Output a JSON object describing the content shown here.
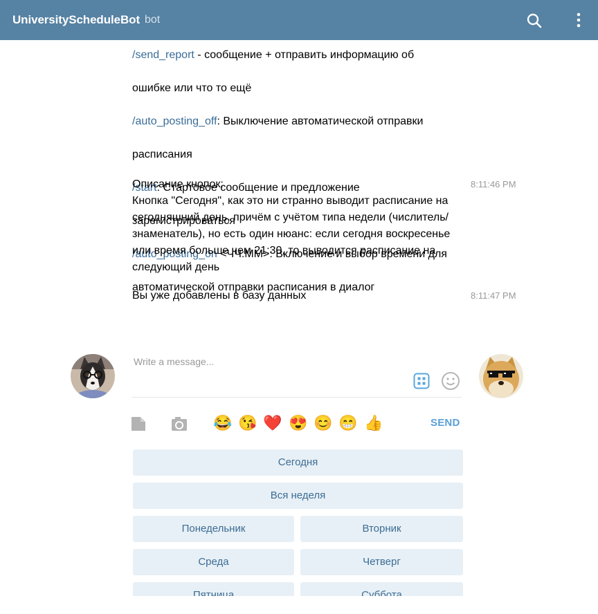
{
  "header": {
    "title": "UniversityScheduleBot",
    "subtitle": "bot"
  },
  "messages": {
    "block1": {
      "line0_cmd": "/send_report",
      "line0_rest": " - сообщение + отправить информацию об",
      "line1": "ошибке или что то ещё",
      "l2_cmd": "/auto_posting_off",
      "l2_rest": ": Выключение автоматической отправки",
      "l3": "расписания",
      "l4_cmd": "/start",
      "l4_rest": ": Стартовое сообщение и предложение",
      "l5": "зарегистрироваться",
      "l6_cmd": "/auto_posting_on",
      "l6_rest": " <ЧЧ:ММ>: Включение и выбор времени для",
      "l7": "автоматической отправки расписания в диалог"
    },
    "block2": {
      "text": "Описание кнопок:\nКнопка \"Сегодня\", как это ни странно выводит расписание на\nсегодняшний день, причём с учётом типа недели (числитель/\nзнаменатель), но есть один нюанс: если сегодня воскресенье\nили время больше чем 21:30, то выводится расписание на\nследующий день",
      "time": "8:11:46 PM"
    },
    "block3": {
      "text": "Вы уже добавлены в базу данных",
      "time": "8:11:47 PM"
    }
  },
  "composer": {
    "placeholder": "Write a message...",
    "send_label": "SEND",
    "emojis": [
      "😂",
      "😘",
      "❤️",
      "😍",
      "😊",
      "😁",
      "👍"
    ]
  },
  "keyboard": {
    "today": "Сегодня",
    "week": "Вся неделя",
    "monday": "Понедельник",
    "tuesday": "Вторник",
    "wednesday": "Среда",
    "thursday": "Четверг",
    "friday": "Пятница",
    "saturday": "Суббота"
  },
  "colors": {
    "header_bg": "#5682a3",
    "command_link": "#3a6d99",
    "send": "#5a9fd6",
    "keyboard_button_bg": "#e7f0f6",
    "keyboard_button_text": "#3d6c93"
  },
  "icons": [
    "search-icon",
    "more-vertical-icon",
    "keyboard-icon",
    "smile-icon",
    "file-icon",
    "camera-icon"
  ]
}
